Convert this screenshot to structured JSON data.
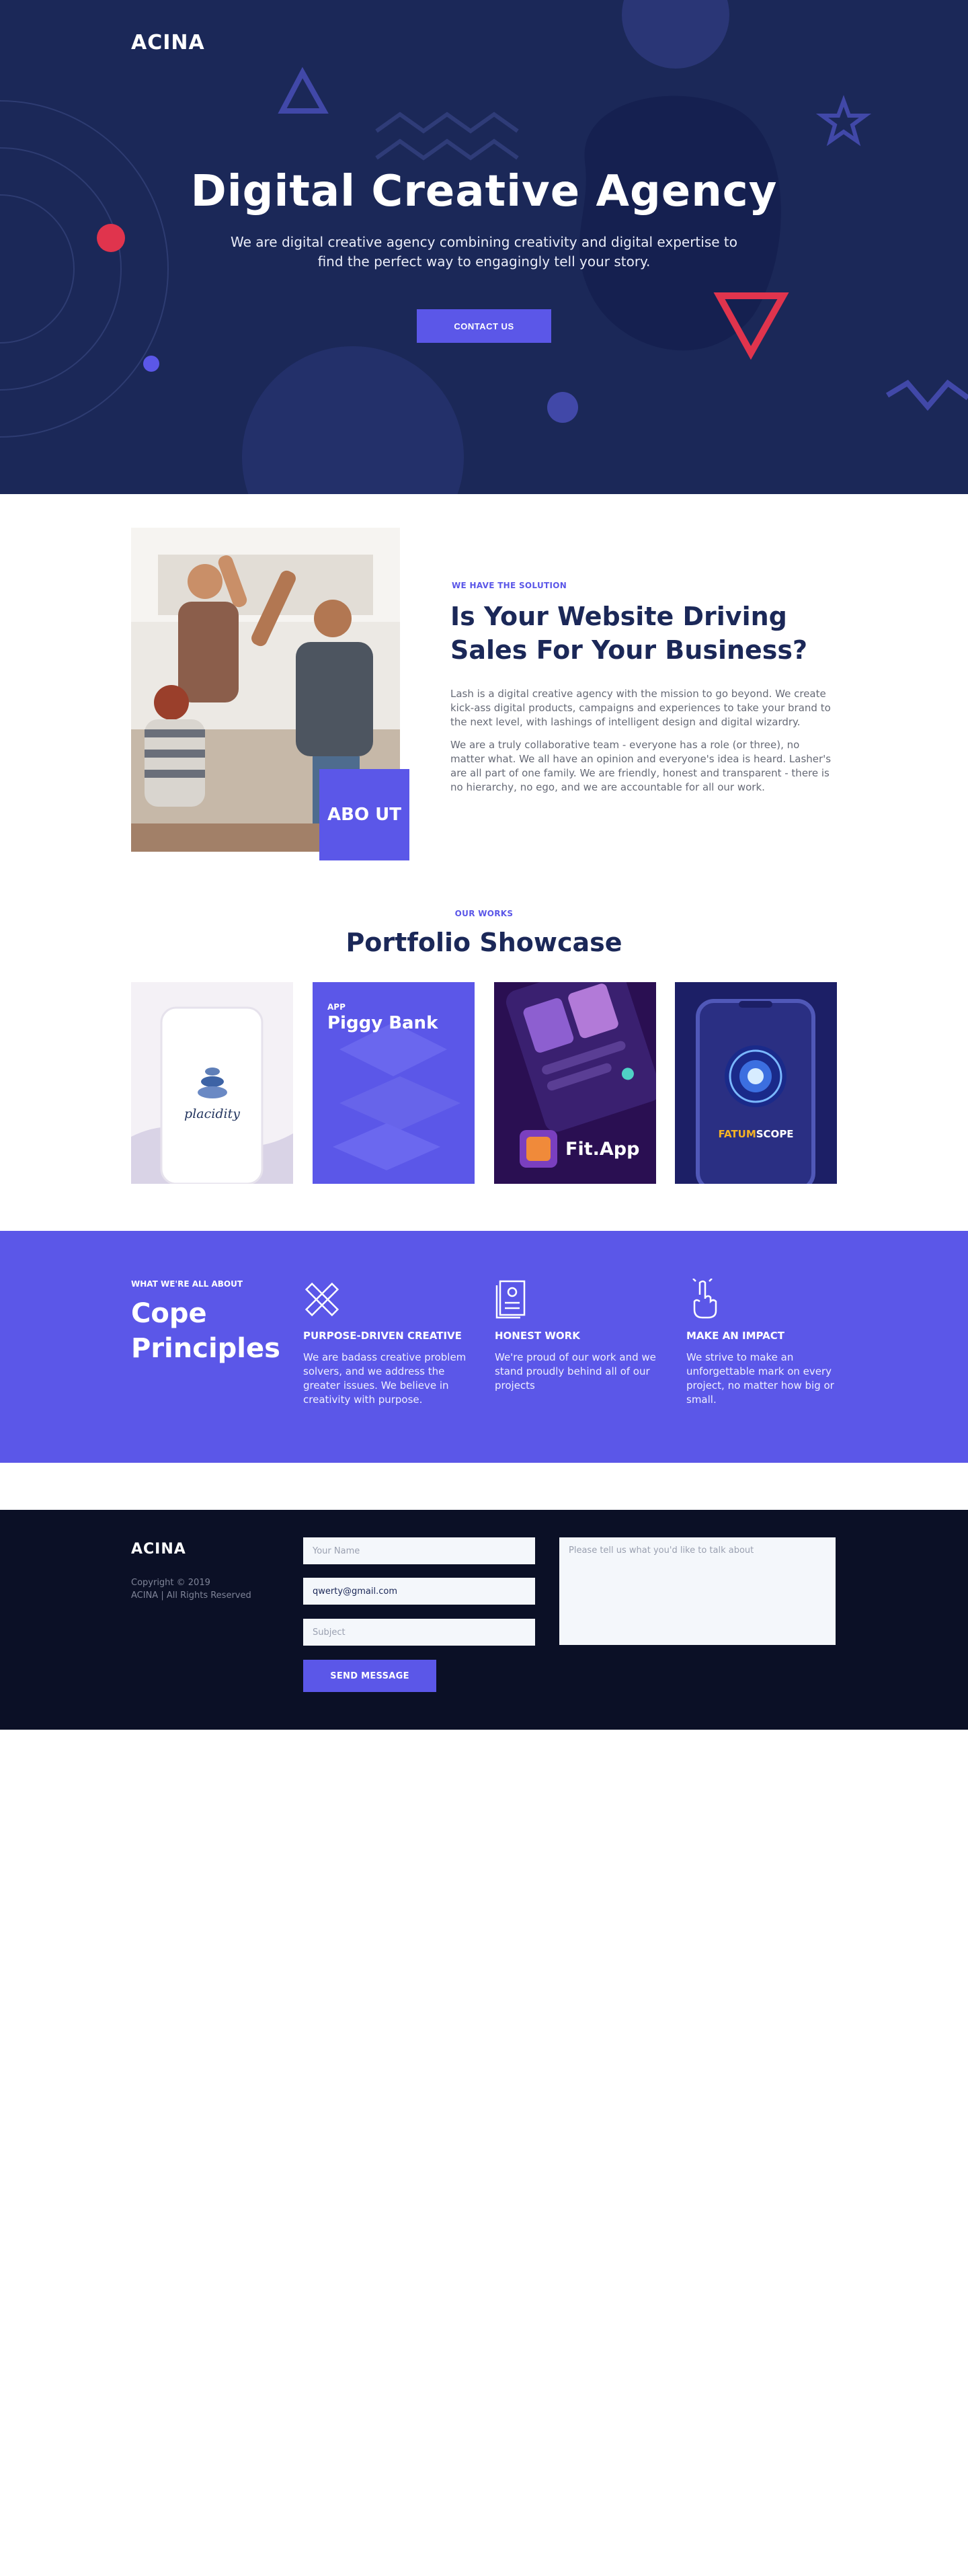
{
  "header": {
    "logo": "ACINA"
  },
  "hero": {
    "title": "Digital Creative Agency",
    "subtitle": "We are digital creative agency combining creativity and digital expertise to find the perfect way to engagingly tell your story.",
    "cta_label": "CONTACT US"
  },
  "about": {
    "badge": "ABO UT",
    "eyebrow": "WE HAVE THE SOLUTION",
    "title": "Is Your Website Driving Sales For Your Business?",
    "paragraphs": [
      "Lash is a digital creative agency with the mission to go beyond. We create kick-ass digital products, campaigns and experiences to take your brand to the next level, with lashings of intelligent design and digital wizardry.",
      "We are a truly collaborative team - everyone has a role (or three), no matter what. We all have an opinion and everyone's idea is heard. Lasher's are all part of one family. We are friendly, honest and transparent - there is no hierarchy, no ego, and we are accountable for all our work."
    ]
  },
  "portfolio": {
    "eyebrow": "OUR WORKS",
    "title": "Portfolio Showcase",
    "items": [
      {
        "name": "placidity"
      },
      {
        "tag": "APP",
        "name": "Piggy Bank"
      },
      {
        "name": "Fit.App"
      },
      {
        "name_a": "FATUM",
        "name_b": "SCOPE"
      }
    ]
  },
  "principles": {
    "eyebrow": "WHAT WE'RE ALL ABOUT",
    "title": "Cope Principles",
    "items": [
      {
        "icon": "pencil-ruler-icon",
        "title": "PURPOSE-DRIVEN CREATIVE",
        "text": "We are badass creative problem solvers, and we address the greater issues. We believe in creativity with purpose."
      },
      {
        "icon": "document-icon",
        "title": "HONEST WORK",
        "text": "We're proud of our work and we stand proudly behind all of our projects"
      },
      {
        "icon": "hand-pointer-icon",
        "title": "MAKE AN IMPACT",
        "text": "We strive to make an unforgettable mark on every project, no matter how big or small."
      }
    ]
  },
  "footer": {
    "logo": "ACINA",
    "copyright": "Copyright © 2019",
    "rights": "ACINA | All Rights Reserved",
    "name_placeholder": "Your Name",
    "email_value": "qwerty@gmail.com",
    "subject_placeholder": "Subject",
    "message_placeholder": "Please tell us what you'd like to talk about",
    "send_label": "SEND MESSAGE"
  },
  "colors": {
    "hero_bg": "#1b2858",
    "accent": "#5b57e8",
    "heading": "#1b2858",
    "footer_bg": "#0b1026",
    "shape_red": "#e0344d"
  }
}
